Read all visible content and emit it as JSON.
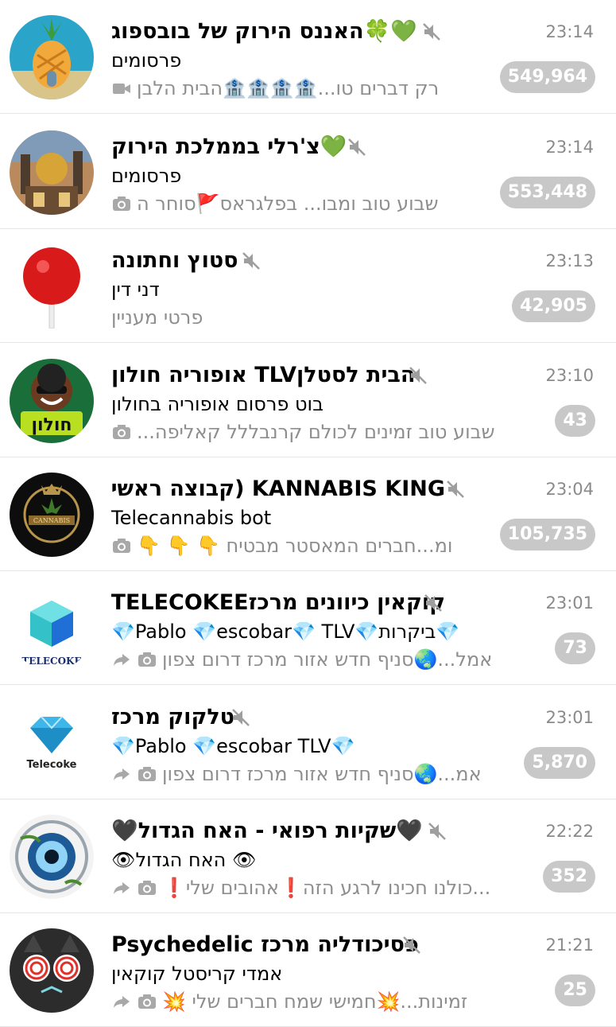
{
  "accent_colors": {
    "badge_muted": "#c8c8c8",
    "divider": "#e6e6e6",
    "secondary_text": "#8e8e8e"
  },
  "chats": [
    {
      "title": "💚🍀האננס הירוק של בובספוג",
      "sender": "פרסומים",
      "preview": "רק דברים טו...🏦🏦🏦🏦הבית הלבן",
      "preview_icons": [
        "video-icon"
      ],
      "time": "23:14",
      "unread": "549,964",
      "muted": true,
      "avatar_icon": "pineapple-house-icon"
    },
    {
      "title": "💚צ'רלי בממלכת הירוק",
      "sender": "פרסומים",
      "preview": "שבוע טוב ומבו...  בפלגראס🚩סוחר ה",
      "preview_icons": [
        "camera-icon"
      ],
      "time": "23:14",
      "unread": "553,448",
      "muted": true,
      "avatar_icon": "factory-icon"
    },
    {
      "title": "סטוץ וחתונה",
      "sender": "דני דין",
      "preview": "פרטי מעניין",
      "preview_icons": [],
      "time": "23:13",
      "unread": "42,905",
      "muted": true,
      "avatar_icon": "lollipop-icon"
    },
    {
      "title": "הבית לסטלןTLV אופוריה חולון",
      "sender": "בוט פרסום אופוריה בחולון",
      "preview": "שבוע טוב זמינים לכולם קרנבללל קאליפה...",
      "preview_icons": [
        "camera-icon"
      ],
      "time": "23:10",
      "unread": "43",
      "muted": true,
      "avatar_icon": "euphoria-logo-icon"
    },
    {
      "title": "KANNABIS KING (קבוצה ראשית)",
      "sender": "Telecannabis bot",
      "preview": "ומ...חברים  המאסטר מבטיח  👇 👇 👇",
      "preview_icons": [
        "camera-icon"
      ],
      "time": "23:04",
      "unread": "105,735",
      "muted": true,
      "avatar_icon": "cannabis-crown-icon"
    },
    {
      "title": "קוקאין כיוונים מרכזTELECOKEE",
      "sender": "💎ביקרות💎Pablo 💎escobar💎 TLV💎",
      "preview": "אמל...🌏סניף חדש אזור מרכז דרום צפון",
      "preview_icons": [
        "forward-icon",
        "camera-icon"
      ],
      "time": "23:01",
      "unread": "73",
      "muted": true,
      "avatar_icon": "cube-logo-icon"
    },
    {
      "title": "טלקוק מרכז",
      "sender": "💎Pablo 💎escobar TLV💎",
      "preview": "אמ...🌏סניף חדש אזור מרכז דרום צפון",
      "preview_icons": [
        "forward-icon",
        "camera-icon"
      ],
      "time": "23:01",
      "unread": "5,870",
      "muted": true,
      "avatar_icon": "diamond-logo-icon"
    },
    {
      "title": "🖤שקיות רפואי - האח הגדול🖤",
      "sender": "👁 האח הגדול👁",
      "preview": "...כולנו חכינו לרגע הזה❗אהובים שלי❗",
      "preview_icons": [
        "forward-icon",
        "camera-icon"
      ],
      "time": "22:22",
      "unread": "352",
      "muted": true,
      "avatar_icon": "eye-logo-icon"
    },
    {
      "title": "פסיכודליה מרכז Psychedelic",
      "sender": "אמדי קריסטל קוקאין",
      "preview": "זמינות...💥חמישי שמח חברים שלי 💥",
      "preview_icons": [
        "forward-icon",
        "camera-icon"
      ],
      "time": "21:21",
      "unread": "25",
      "muted": true,
      "avatar_icon": "hypno-cat-icon"
    }
  ]
}
